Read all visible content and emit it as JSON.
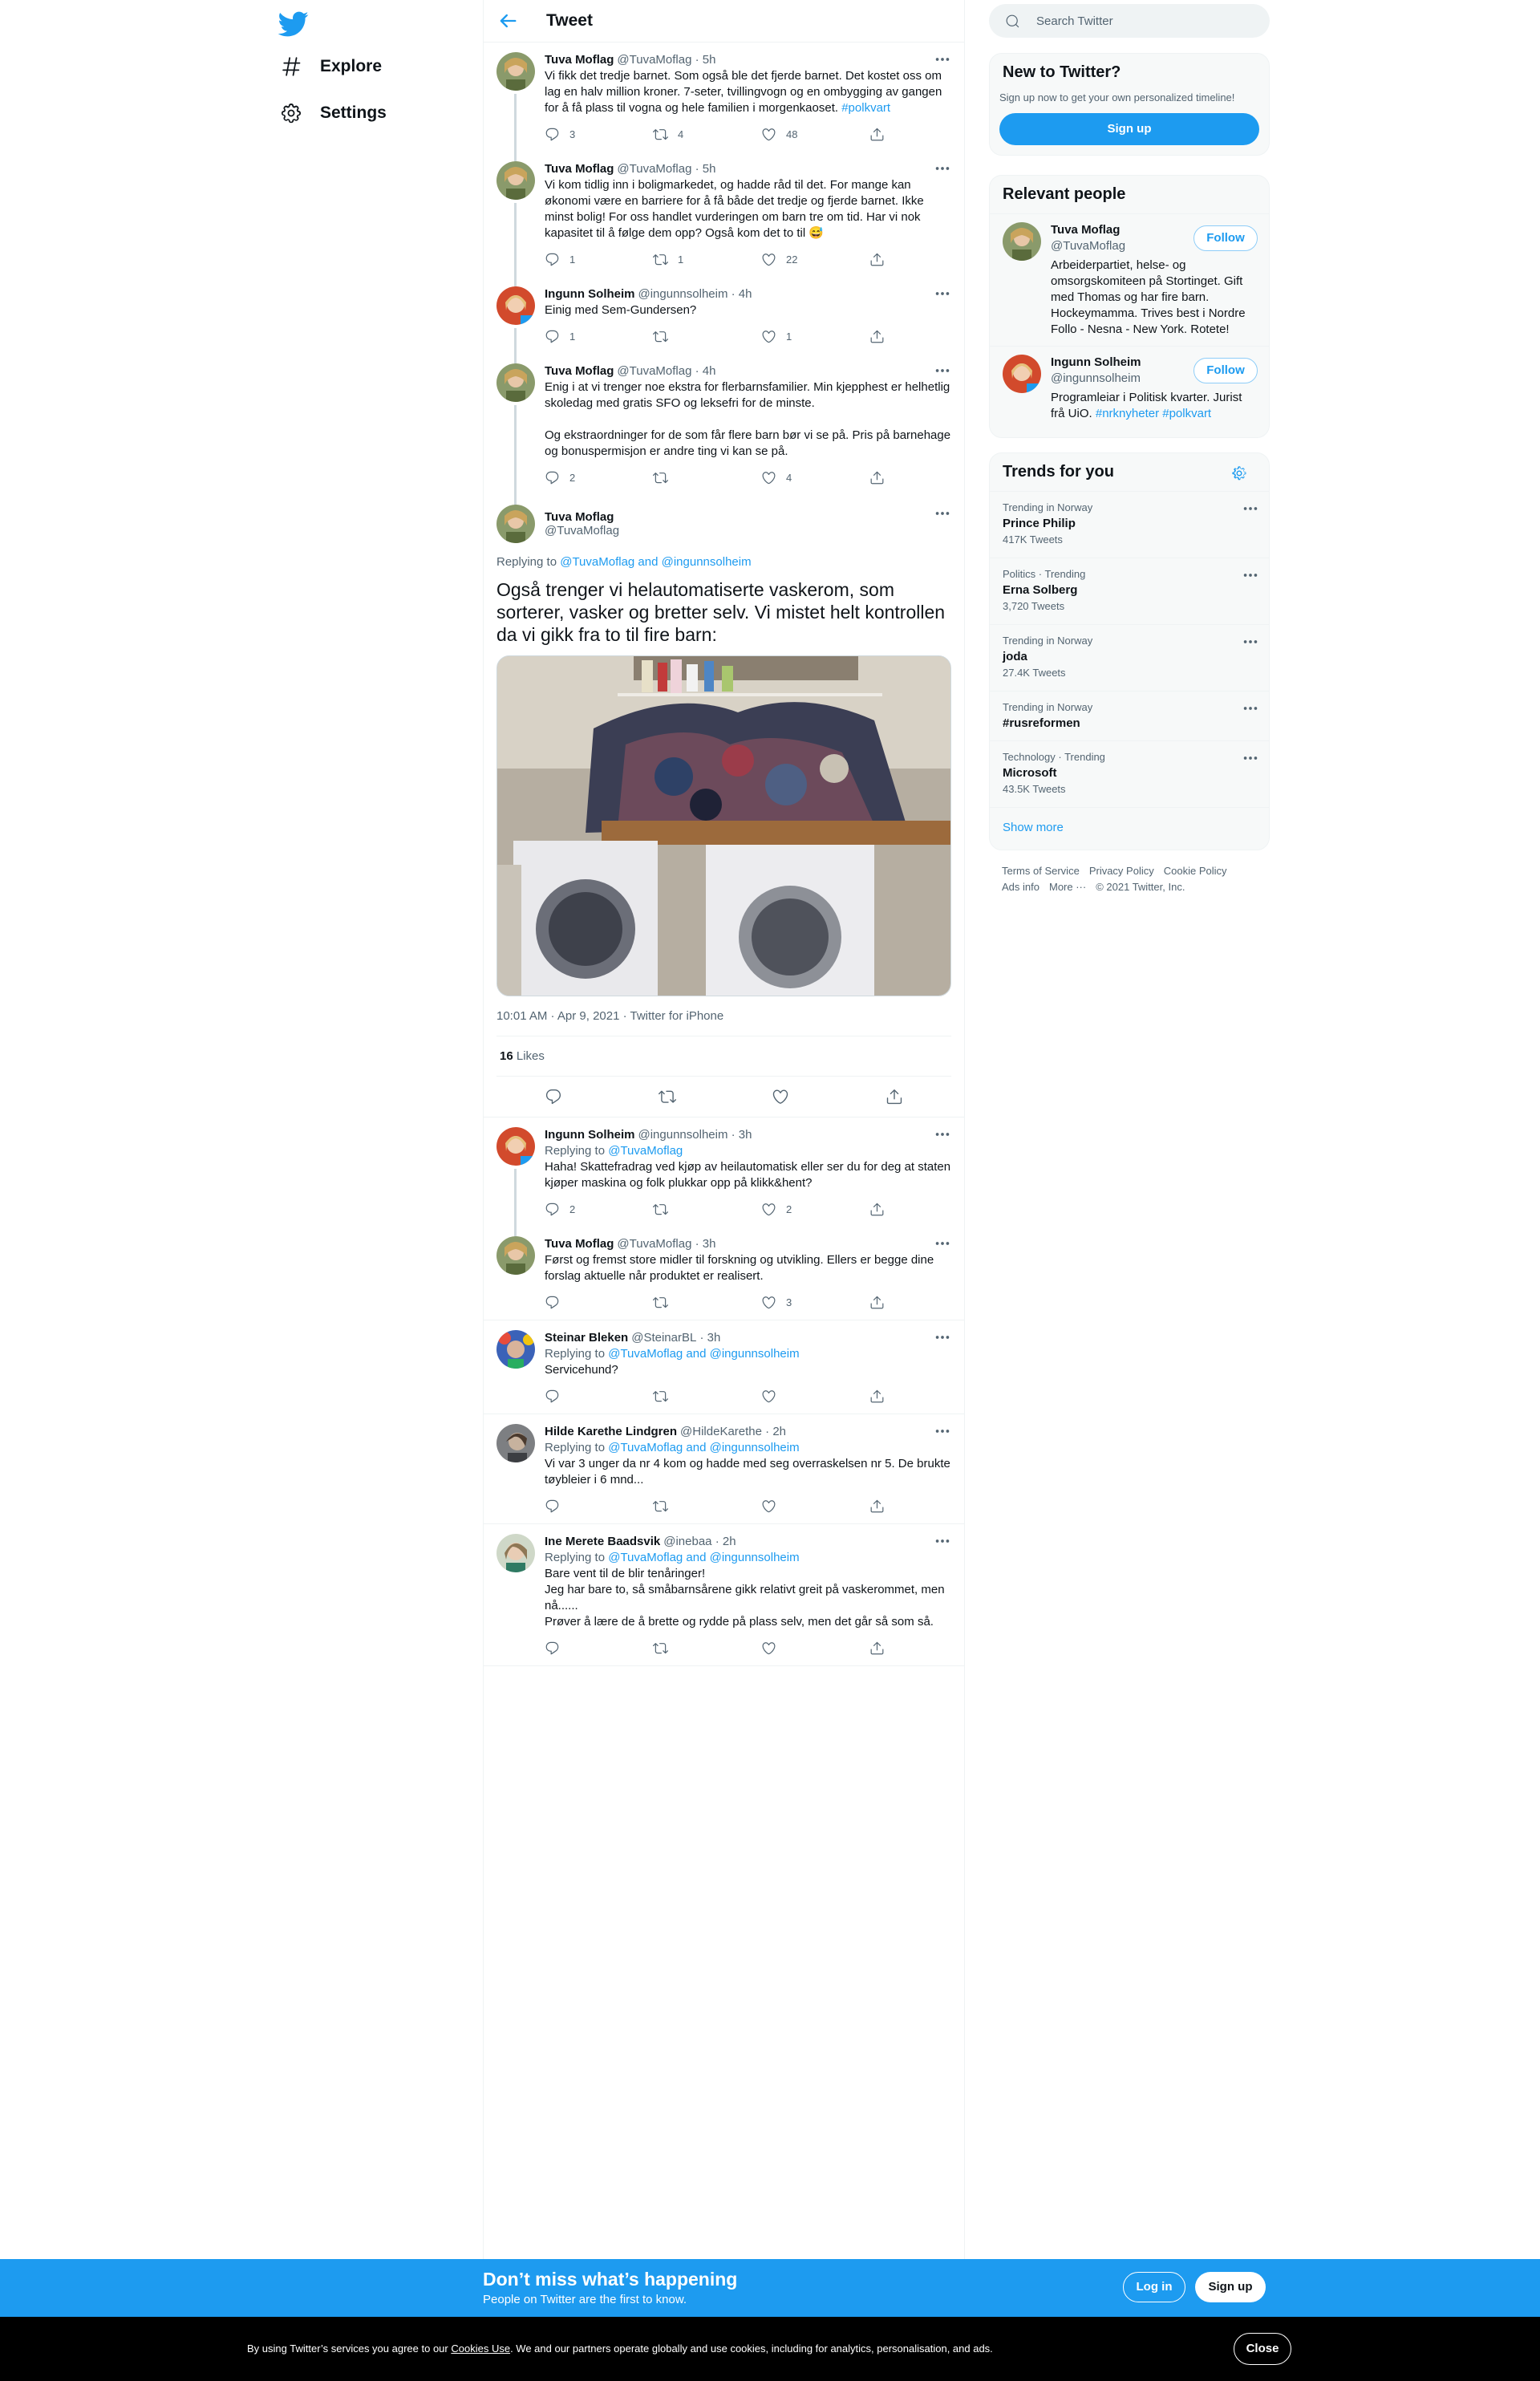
{
  "nav": {
    "items": [
      {
        "label": "Explore"
      },
      {
        "label": "Settings"
      }
    ]
  },
  "header": {
    "title": "Tweet"
  },
  "thread": [
    {
      "name": "Tuva Moflag",
      "handle": "@TuvaMoflag",
      "time": "· 5h",
      "text": "Vi fikk det tredje barnet. Som også ble det fjerde barnet. Det kostet oss om lag en halv million kroner. 7-seter, tvillingvogn og en ombygging av gangen for å få plass til vogna og hele familien i morgenkaoset.",
      "hashtag": "#polkvart",
      "replies": "3",
      "retweets": "4",
      "likes": "48"
    },
    {
      "name": "Tuva Moflag",
      "handle": "@TuvaMoflag",
      "time": "· 5h",
      "text": "Vi kom tidlig inn i boligmarkedet, og hadde råd til det. For mange kan økonomi være en barriere for å få både det tredje og fjerde barnet. Ikke minst bolig! For oss handlet vurderingen om barn tre om tid. Har vi nok kapasitet til å følge dem opp? Også kom det to til 😅",
      "replies": "1",
      "retweets": "1",
      "likes": "22"
    },
    {
      "name": "Ingunn Solheim",
      "handle": "@ingunnsolheim",
      "time": "· 4h",
      "text": "Einig med Sem-Gundersen?",
      "replies": "1",
      "retweets": "",
      "likes": "1"
    },
    {
      "name": "Tuva Moflag",
      "handle": "@TuvaMoflag",
      "time": "· 4h",
      "text": "Enig i at vi trenger noe ekstra for flerbarnsfamilier. Min kjepphest er helhetlig skoledag med gratis SFO og leksefri for de minste.\n\nOg ekstraordninger for de som får flere barn bør vi se på. Pris på barnehage og bonuspermisjon er andre ting vi kan se på.",
      "replies": "2",
      "retweets": "",
      "likes": "4"
    }
  ],
  "focused": {
    "name": "Tuva Moflag",
    "handle": "@TuvaMoflag",
    "replying_prefix": "Replying to",
    "replying_to": "@TuvaMoflag and @ingunnsolheim",
    "text": "Også trenger vi helautomatiserte vaskerom, som sorterer, vasker og bretter selv. Vi mistet helt kontrollen da vi gikk fra to til fire barn:",
    "timestamp": "10:01 AM · Apr 9, 2021 · Twitter for iPhone",
    "likes_count": "16",
    "likes_label": "Likes"
  },
  "replies": [
    {
      "name": "Ingunn Solheim",
      "handle": "@ingunnsolheim",
      "time": "· 3h",
      "replying_to": "@TuvaMoflag",
      "text": "Haha! Skattefradrag ved kjøp av heilautomatisk eller ser du for deg at staten kjøper maskina og folk plukkar opp på klikk&hent?",
      "replies": "2",
      "retweets": "",
      "likes": "2"
    },
    {
      "name": "Tuva Moflag",
      "handle": "@TuvaMoflag",
      "time": "· 3h",
      "replying_to": "",
      "text": "Først og fremst store midler til forskning og utvikling. Ellers er begge dine forslag aktuelle når produktet er realisert.",
      "replies": "",
      "retweets": "",
      "likes": "3"
    },
    {
      "name": "Steinar Bleken",
      "handle": "@SteinarBL",
      "time": "· 3h",
      "replying_to": "@TuvaMoflag and @ingunnsolheim",
      "text": "Servicehund?",
      "replies": "",
      "retweets": "",
      "likes": ""
    },
    {
      "name": "Hilde Karethe Lindgren",
      "handle": "@HildeKarethe",
      "time": "· 2h",
      "replying_to": "@TuvaMoflag and @ingunnsolheim",
      "text": "Vi var 3 unger da nr 4 kom og hadde med seg overraskelsen nr 5. De brukte tøybleier i 6 mnd...",
      "replies": "",
      "retweets": "",
      "likes": ""
    },
    {
      "name": "Ine Merete Baadsvik",
      "handle": "@inebaa",
      "time": "· 2h",
      "replying_to": "@TuvaMoflag and @ingunnsolheim",
      "text": "Bare vent til de blir tenåringer!\nJeg har bare to, så småbarnsårene gikk relativt greit på vaskerommet, men nå......\nPrøver å lære de å brette og rydde på plass selv, men det går så som så.",
      "replies": "",
      "retweets": "",
      "likes": ""
    }
  ],
  "search": {
    "placeholder": "Search Twitter"
  },
  "new_to_twitter": {
    "title": "New to Twitter?",
    "subtitle": "Sign up now to get your own personalized timeline!",
    "button": "Sign up"
  },
  "relevant_people": {
    "title": "Relevant people",
    "people": [
      {
        "name": "Tuva Moflag",
        "handle": "@TuvaMoflag",
        "follow": "Follow",
        "bio": "Arbeiderpartiet, helse- og omsorgskomiteen på Stortinget. Gift med Thomas og har fire barn. Hockeymamma. Trives best i Nordre Follo - Nesna - New York. Rotete!"
      },
      {
        "name": "Ingunn Solheim",
        "handle": "@ingunnsolheim",
        "follow": "Follow",
        "bio": "Programleiar i Politisk kvarter. Jurist frå UiO.",
        "bio_tags": "#nrknyheter #polkvart"
      }
    ]
  },
  "trends": {
    "title": "Trends for you",
    "items": [
      {
        "context": "Trending in Norway",
        "name": "Prince Philip",
        "count": "417K Tweets"
      },
      {
        "context": "Politics · Trending",
        "name": "Erna Solberg",
        "count": "3,720 Tweets"
      },
      {
        "context": "Trending in Norway",
        "name": "joda",
        "count": "27.4K Tweets"
      },
      {
        "context": "Trending in Norway",
        "name": "#rusreformen",
        "count": ""
      },
      {
        "context": "Technology · Trending",
        "name": "Microsoft",
        "count": "43.5K Tweets"
      }
    ],
    "show_more": "Show more"
  },
  "footer": {
    "links": [
      "Terms of Service",
      "Privacy Policy",
      "Cookie Policy",
      "Ads info",
      "More ···"
    ],
    "copyright": "© 2021 Twitter, Inc."
  },
  "bottom_bar": {
    "title": "Don’t miss what’s happening",
    "subtitle": "People on Twitter are the first to know.",
    "login": "Log in",
    "signup": "Sign up"
  },
  "cookie_bar": {
    "text_before": "By using Twitter’s services you agree to our",
    "link": "Cookies Use",
    "text_after": ". We and our partners operate globally and use cookies, including for analytics, personalisation, and ads.",
    "close": "Close"
  },
  "colors": {
    "accent": "#1d9bf0",
    "text": "#0f1419",
    "secondary": "#536471"
  }
}
